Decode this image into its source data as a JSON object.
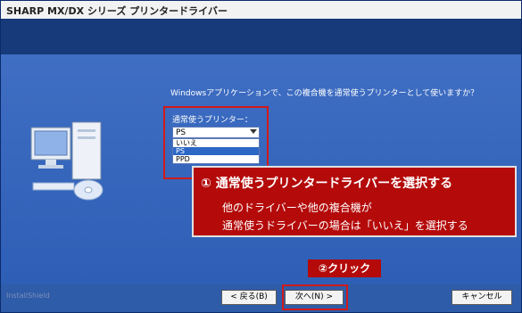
{
  "window": {
    "title": "SHARP MX/DX シリーズ プリンタードライバー"
  },
  "content": {
    "question": "Windowsアプリケーションで、この複合機を通常使うプリンターとして使いますか？",
    "label": "通常使うプリンター：",
    "select": {
      "value": "PS",
      "options": [
        "いいえ",
        "PS",
        "PPD"
      ]
    }
  },
  "callout": {
    "title": "①  通常使うプリンタードライバーを選択する",
    "line1": "他のドライバーや他の複合機が",
    "line2": "通常使うドライバーの場合は「いいえ」を選択する",
    "click": "②クリック"
  },
  "footer": {
    "installshield": "InstallShield",
    "back_label": "< 戻る(B)",
    "next_label": "次へ(N) >",
    "cancel_label": "キャンセル"
  },
  "colors": {
    "accent_red": "#b40a0a",
    "bg_blue": "#2a55a3"
  },
  "icons": {
    "pc_illustration": "computer-with-cd-icon",
    "dropdown": "chevron-down-icon"
  }
}
